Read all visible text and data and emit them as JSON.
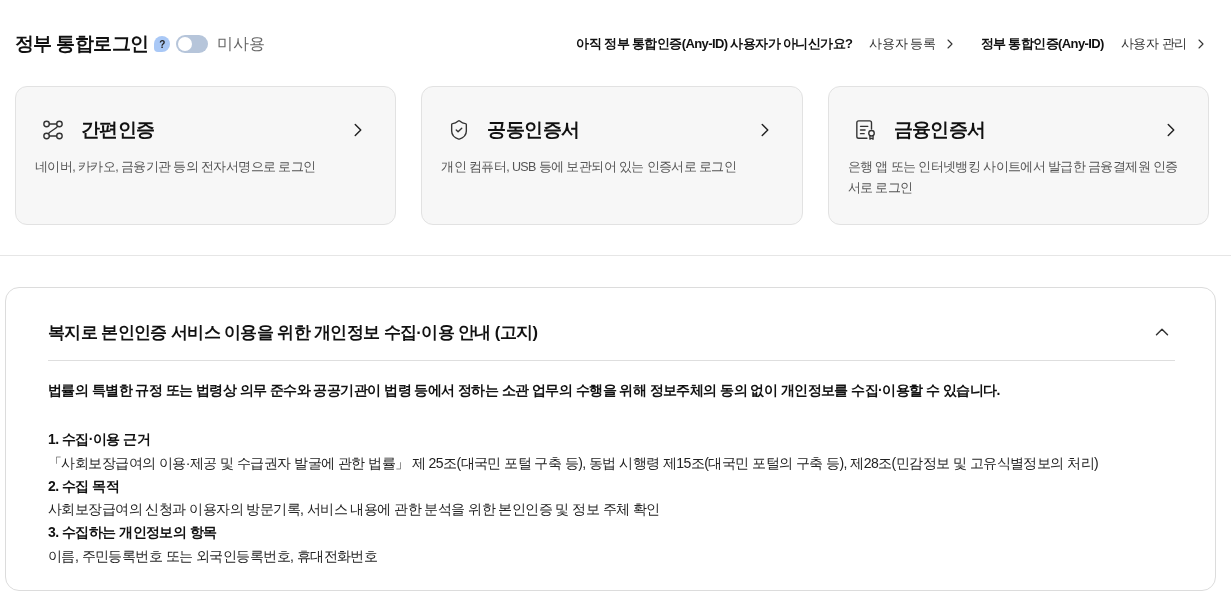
{
  "header": {
    "title": "정부 통합로그인",
    "help": {
      "label": "?"
    },
    "toggle": {
      "on": false,
      "label": "미사용"
    },
    "links": [
      {
        "prompt": "아직 정부 통합인증(Any-ID) 사용자가 아니신가요?",
        "link": "사용자 등록"
      },
      {
        "prompt": "정부 통합인증(Any-ID)",
        "link": "사용자 관리"
      }
    ]
  },
  "login_options": [
    {
      "kind": "simple",
      "title": "간편인증",
      "description": "네이버, 카카오, 금융기관 등의 전자서명으로 로그인"
    },
    {
      "kind": "joint",
      "title": "공동인증서",
      "description": "개인 컴퓨터, USB 등에 보관되어 있는 인증서로 로그인"
    },
    {
      "kind": "financial",
      "title": "금융인증서",
      "description": "은행 앱 또는 인터넷뱅킹 사이트에서 발급한 금융결제원 인증서로 로그인"
    }
  ],
  "notice": {
    "title": "복지로 본인인증 서비스 이용을 위한 개인정보 수집·이용 안내 (고지)",
    "expanded": true,
    "lead": "법률의 특별한 규정 또는 법령상 의무 준수와 공공기관이 법령 등에서 정하는 소관 업무의 수행을 위해 정보주체의 동의 없이 개인정보를 수집·이용할 수 있습니다.",
    "sections": [
      {
        "heading": "1. 수집·이용 근거",
        "body": "「사회보장급여의 이용·제공 및 수급권자 발굴에 관한 법률」 제 25조(대국민 포털 구축 등), 동법 시행령 제15조(대국민 포털의 구축 등), 제28조(민감정보 및 고유식별정보의 처리)"
      },
      {
        "heading": "2. 수집 목적",
        "body": "사회보장급여의 신청과 이용자의 방문기록, 서비스 내용에 관한 분석을 위한 본인인증 및 정보 주체 확인"
      },
      {
        "heading": "3. 수집하는 개인정보의 항목",
        "body": "이름, 주민등록번호 또는 외국인등록번호, 휴대전화번호"
      }
    ]
  }
}
